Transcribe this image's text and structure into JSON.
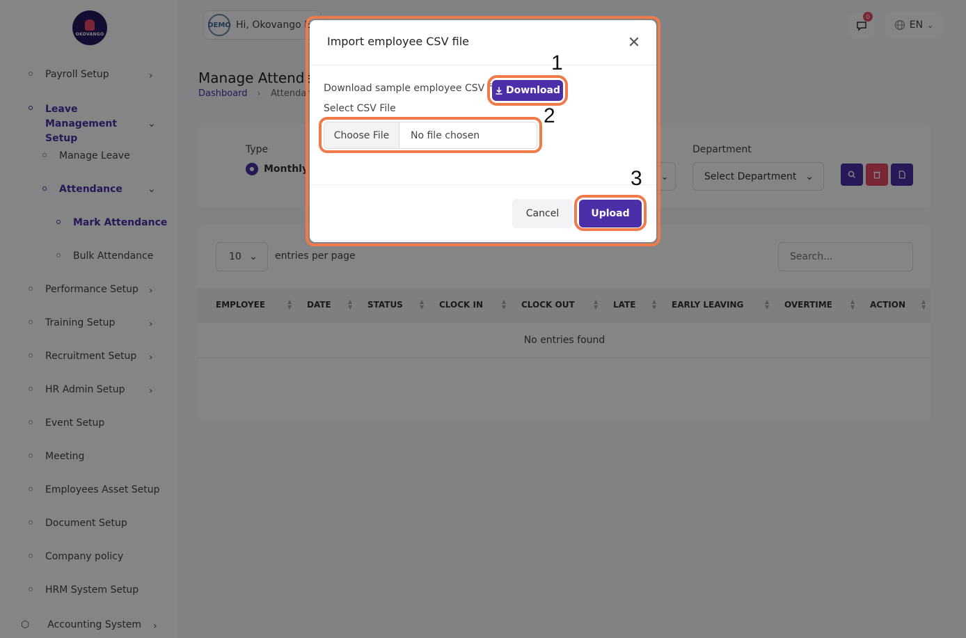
{
  "sidebar": {
    "logo_text": "OKOVANGO",
    "items": [
      {
        "label": "Payroll Setup"
      },
      {
        "label": "Leave Management Setup"
      },
      {
        "label": "Manage Leave"
      },
      {
        "label": "Attendance"
      },
      {
        "label": "Mark Attendance"
      },
      {
        "label": "Bulk Attendance"
      },
      {
        "label": "Performance Setup"
      },
      {
        "label": "Training Setup"
      },
      {
        "label": "Recruitment Setup"
      },
      {
        "label": "HR Admin Setup"
      },
      {
        "label": "Event Setup"
      },
      {
        "label": "Meeting"
      },
      {
        "label": "Employees Asset Setup"
      },
      {
        "label": "Document Setup"
      },
      {
        "label": "Company policy"
      },
      {
        "label": "HRM System Setup"
      },
      {
        "label": "Accounting System"
      }
    ]
  },
  "topbar": {
    "greeting": "Hi, Okovango Ed",
    "demo_label": "DEMO",
    "notification_count": "0",
    "language": "EN"
  },
  "page": {
    "title": "Manage Attendar",
    "breadcrumb": [
      "Dashboard",
      "Attendan"
    ]
  },
  "filters": {
    "type_label": "Type",
    "type_selected": "Monthly",
    "department_label": "Department",
    "department_value": "Select Department"
  },
  "table": {
    "entries_value": "10",
    "entries_label": "entries per page",
    "search_placeholder": "Search...",
    "columns": [
      "EMPLOYEE",
      "DATE",
      "STATUS",
      "CLOCK IN",
      "CLOCK OUT",
      "LATE",
      "EARLY LEAVING",
      "OVERTIME",
      "ACTION"
    ],
    "empty_text": "No entries found"
  },
  "modal": {
    "title": "Import employee CSV file",
    "download_label": "Download sample employee CSV file",
    "download_button": "Download",
    "csv_label": "Select CSV File",
    "choose_file": "Choose File",
    "no_file": "No file chosen",
    "cancel": "Cancel",
    "upload": "Upload"
  },
  "annotations": {
    "step1": "1",
    "step2": "2",
    "step3": "3",
    "highlight_color": "#f07a4a"
  },
  "colors": {
    "primary": "#4b2ea8",
    "danger": "#e94c6a"
  }
}
